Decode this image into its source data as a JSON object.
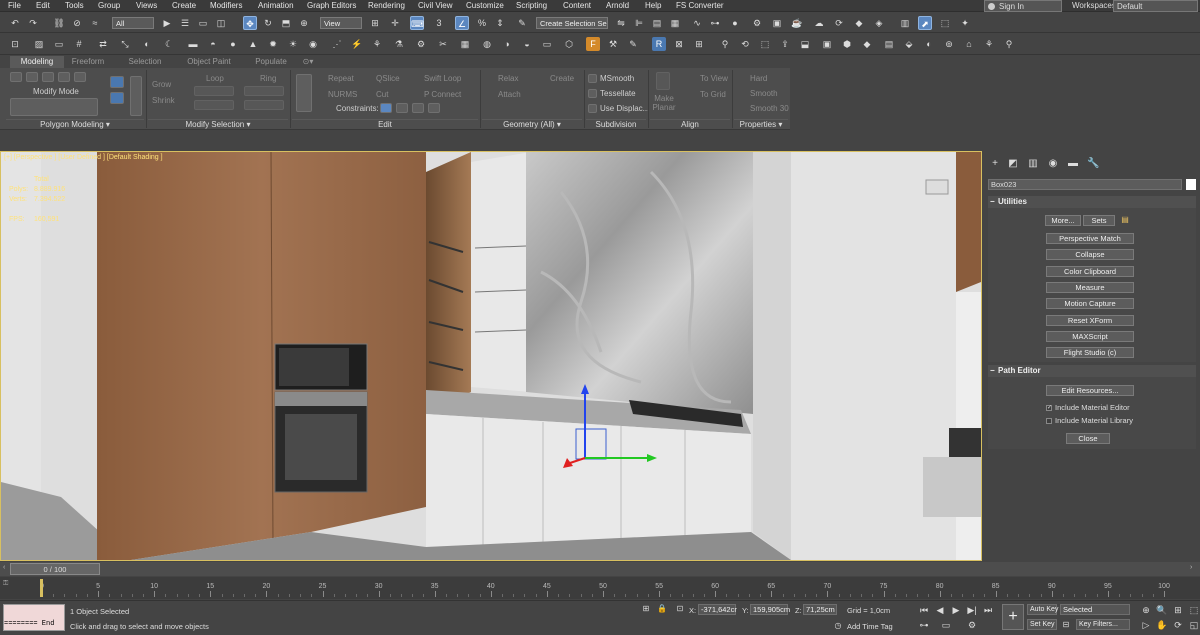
{
  "menu": [
    "File",
    "Edit",
    "Tools",
    "Group",
    "Views",
    "Create",
    "Modifiers",
    "Animation",
    "Graph Editors",
    "Rendering",
    "Civil View",
    "Customize",
    "Scripting",
    "Content",
    "Arnold",
    "Help",
    "FS Converter"
  ],
  "account": {
    "sign_in": "Sign In",
    "workspaces_label": "Workspaces:",
    "workspace": "Default"
  },
  "toolbar1": {
    "filter": "All",
    "ref_coord": "View",
    "selection_set": "Create Selection Se"
  },
  "ribbon": {
    "tabs": [
      "Modeling",
      "Freeform",
      "Selection",
      "Object Paint",
      "Populate"
    ],
    "mode": "Modify Mode",
    "groups": [
      "Polygon Modeling",
      "Modify Selection",
      "Edit",
      "Geometry (All)",
      "Subdivision",
      "Align",
      "Properties"
    ],
    "modify_sel": {
      "grow": "Grow",
      "shrink": "Shrink",
      "loop": "Loop",
      "ring": "Ring"
    },
    "edit": {
      "repeat": "Repeat",
      "nurms": "NURMS",
      "qslice": "QSlice",
      "cut": "Cut",
      "swiftloop": "Swift Loop",
      "pconnect": "P Connect",
      "constraints": "Constraints:"
    },
    "geometry": {
      "relax": "Relax",
      "create": "Create",
      "attach": "Attach"
    },
    "subdivision": {
      "msmooth": "MSmooth",
      "tessellate": "Tessellate",
      "use_displac": "Use Displac..."
    },
    "align": {
      "make_planar": "Make Planar",
      "to_view": "To View",
      "to_grid": "To Grid"
    },
    "properties": {
      "hard": "Hard",
      "smooth": "Smooth",
      "smooth30": "Smooth 30"
    }
  },
  "viewport": {
    "label": "[+] [Perspective ] [User Defined ] [Default Shading ]",
    "stats": {
      "total": "Total",
      "polys_label": "Polys:",
      "polys": "8.889.916",
      "verts_label": "Verts:",
      "verts": "7.394.522",
      "fps_label": "FPS:",
      "fps": "160,591"
    }
  },
  "command_panel": {
    "object_name": "Box023",
    "utilities": {
      "title": "Utilities",
      "more": "More...",
      "sets": "Sets",
      "buttons": [
        "Perspective Match",
        "Collapse",
        "Color Clipboard",
        "Measure",
        "Motion Capture",
        "Reset XForm",
        "MAXScript",
        "Flight Studio (c)"
      ]
    },
    "path_editor": {
      "title": "Path Editor",
      "edit_resources": "Edit Resources...",
      "include_material_editor": "Include Material Editor",
      "include_material_library": "Include Material Library",
      "close": "Close",
      "material_editor_checked": true,
      "material_library_checked": false
    }
  },
  "timeline": {
    "frame": "0 / 100",
    "ticks": [
      "0",
      "5",
      "10",
      "15",
      "20",
      "25",
      "30",
      "35",
      "40",
      "45",
      "50",
      "55",
      "60",
      "65",
      "70",
      "75",
      "80",
      "85",
      "90",
      "95",
      "100"
    ]
  },
  "status": {
    "maxscript_end": "======== End",
    "selected": "1 Object Selected",
    "prompt": "Click and drag to select and move objects",
    "x_label": "X:",
    "x": "-371,642cr",
    "y_label": "Y:",
    "y": "159,905cm",
    "z_label": "Z:",
    "z": "71,25cm",
    "grid": "Grid = 1,0cm",
    "add_time_tag": "Add Time Tag",
    "auto_key": "Auto Key",
    "set_key": "Set Key",
    "selected_dd": "Selected",
    "key_filters": "Key Filters..."
  }
}
